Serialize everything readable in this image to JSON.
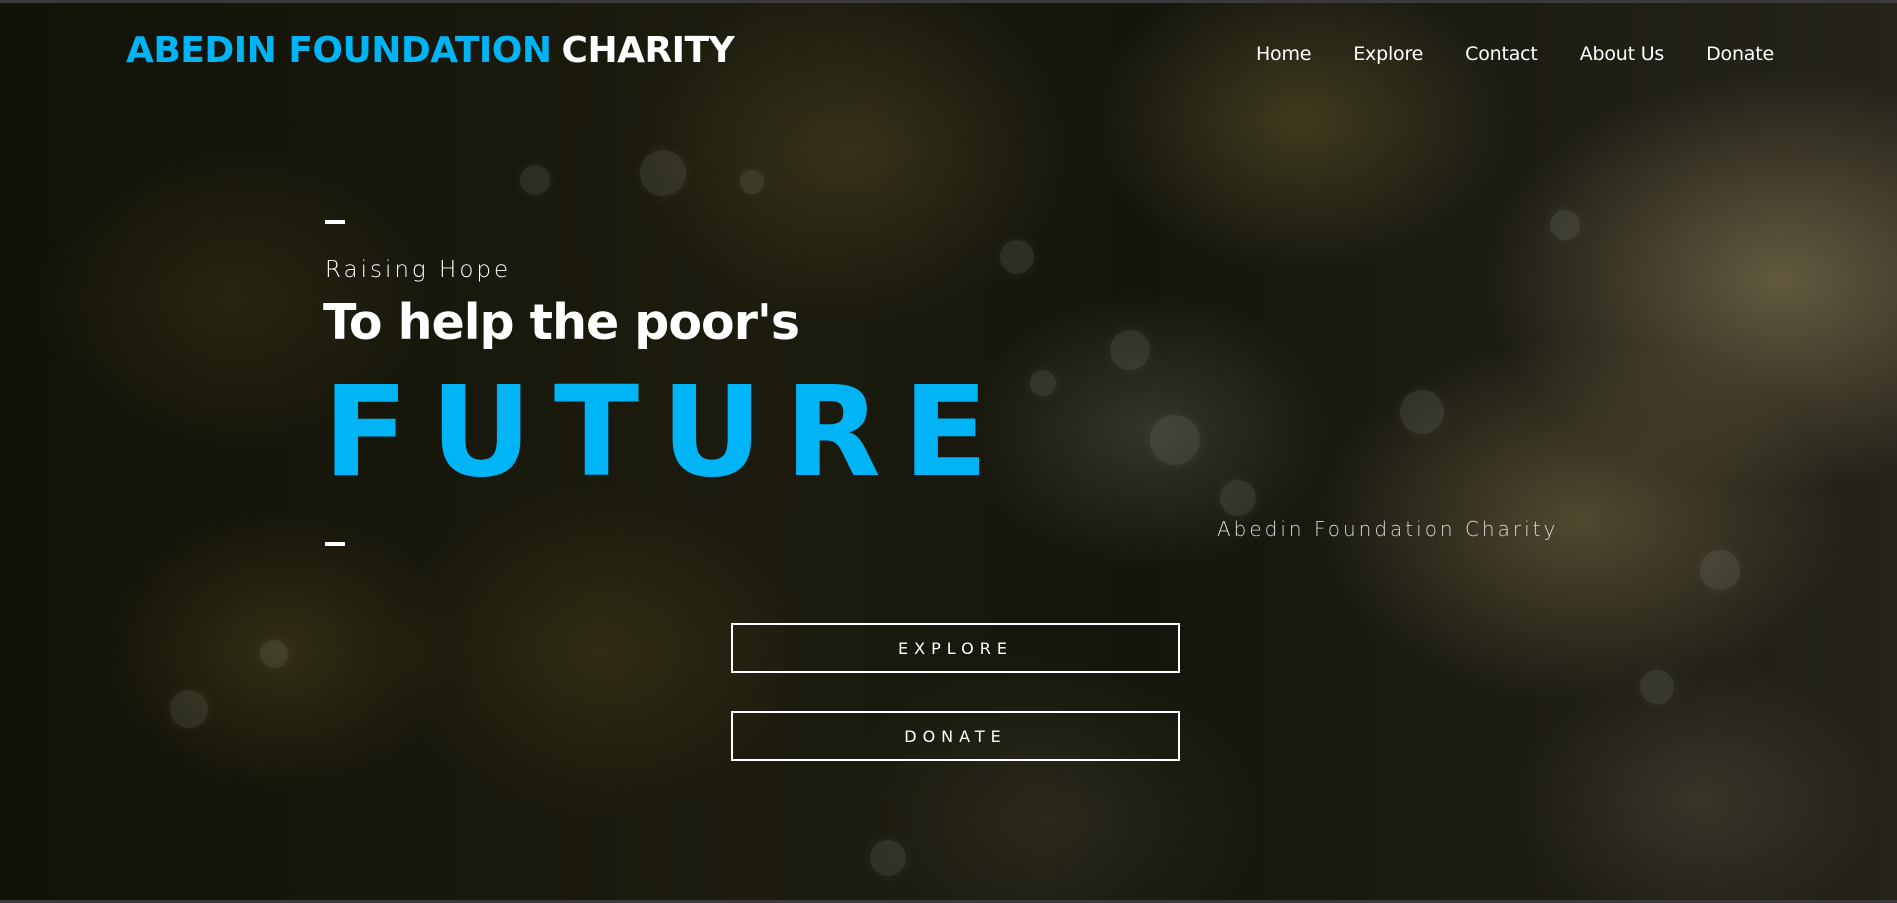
{
  "header": {
    "brand_part1": "ABEDIN FOUNDATION",
    "brand_part2": "CHARITY",
    "nav": [
      "Home",
      "Explore",
      "Contact",
      "About Us",
      "Donate"
    ]
  },
  "hero": {
    "kicker": "Raising Hope",
    "headline": "To help the poor's",
    "highlight": "FUTURE",
    "subbrand": "Abedin Foundation Charity",
    "explore_label": "EXPLORE",
    "donate_label": "DONATE"
  },
  "colors": {
    "accent": "#00b4f5",
    "text": "#ffffff",
    "background": "#15150d"
  }
}
